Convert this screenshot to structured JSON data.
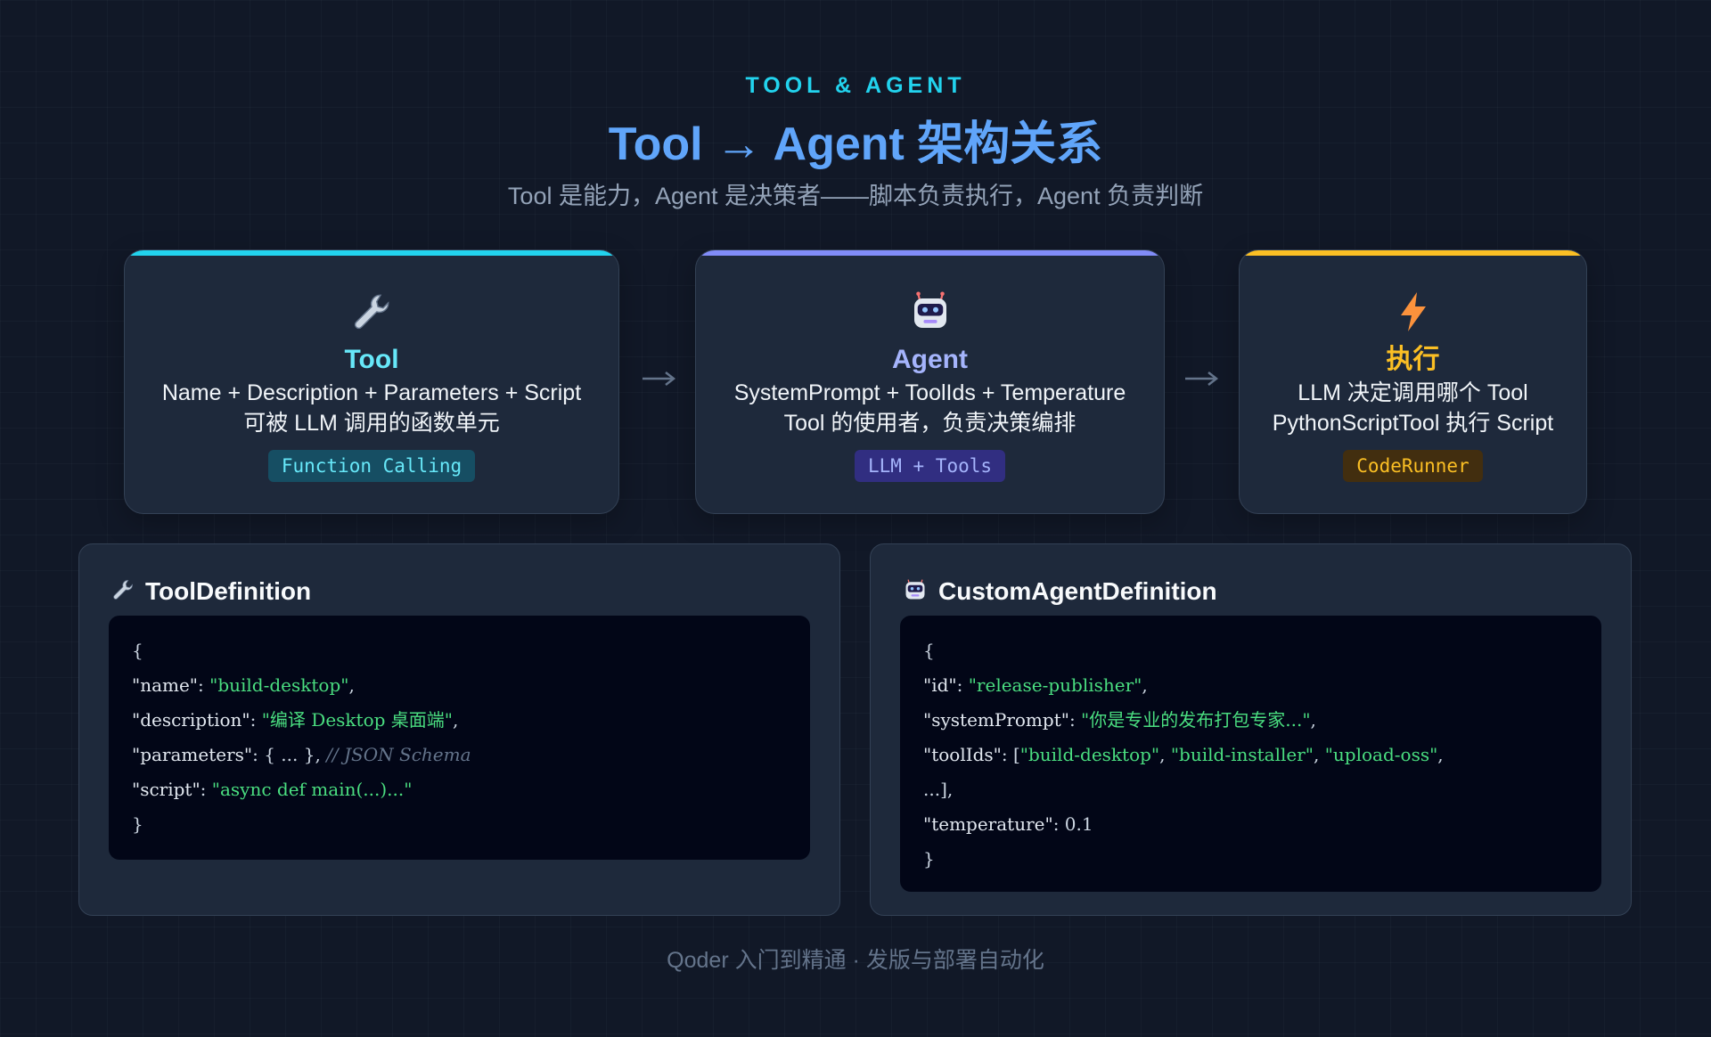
{
  "header": {
    "kicker": "TOOL & AGENT",
    "title": "Tool → Agent 架构关系",
    "subtitle": "Tool 是能力，Agent 是决策者——脚本负责执行，Agent 负责判断"
  },
  "cards": [
    {
      "icon": "wrench-icon",
      "title": "Tool",
      "lines": [
        "Name + Description + Parameters + Script",
        "可被 LLM 调用的函数单元"
      ],
      "tag": "Function Calling",
      "accent": "#22d3ee",
      "title_color": "#67e8f9",
      "tag_text_color": "#67e8f9",
      "tag_bg": "#164e63"
    },
    {
      "icon": "robot-icon",
      "title": "Agent",
      "lines": [
        "SystemPrompt + ToolIds + Temperature",
        "Tool 的使用者，负责决策编排"
      ],
      "tag": "LLM + Tools",
      "accent": "#818cf8",
      "title_color": "#a5b4fc",
      "tag_text_color": "#a5b4fc",
      "tag_bg": "#312e81"
    },
    {
      "icon": "lightning-icon",
      "title": "执行",
      "lines": [
        "LLM 决定调用哪个 Tool",
        "PythonScriptTool 执行 Script"
      ],
      "tag": "CodeRunner",
      "accent": "#fbbf24",
      "title_color": "#fbbf24",
      "tag_text_color": "#fbbf24",
      "tag_bg": "#422e0f"
    }
  ],
  "arrows": [
    "→",
    "→"
  ],
  "panels": {
    "tool": {
      "icon": "wrench-icon",
      "title": "ToolDefinition",
      "code": {
        "open": "{",
        "name_key": "\"name\"",
        "name_val": "\"build-desktop\"",
        "desc_key": "\"description\"",
        "desc_val": "\"编译 Desktop 桌面端\"",
        "params_key": "\"parameters\"",
        "params_val": "{ ... }",
        "params_comment": "// JSON Schema",
        "script_key": "\"script\"",
        "script_val": "\"async def main(...)...\"",
        "close": "}"
      }
    },
    "agent": {
      "icon": "robot-icon",
      "title": "CustomAgentDefinition",
      "code": {
        "open": "{",
        "id_key": "\"id\"",
        "id_val": "\"release-publisher\"",
        "prompt_key": "\"systemPrompt\"",
        "prompt_val": "\"你是专业的发布打包专家...\"",
        "tools_key": "\"toolIds\"",
        "tools_val1": "\"build-desktop\"",
        "tools_val2": "\"build-installer\"",
        "tools_val3": "\"upload-oss\"",
        "tools_rest": "...],",
        "temp_key": "\"temperature\"",
        "temp_val": "0.1",
        "close": "}"
      }
    }
  },
  "footer": "Qoder 入门到精通 · 发版与部署自动化"
}
